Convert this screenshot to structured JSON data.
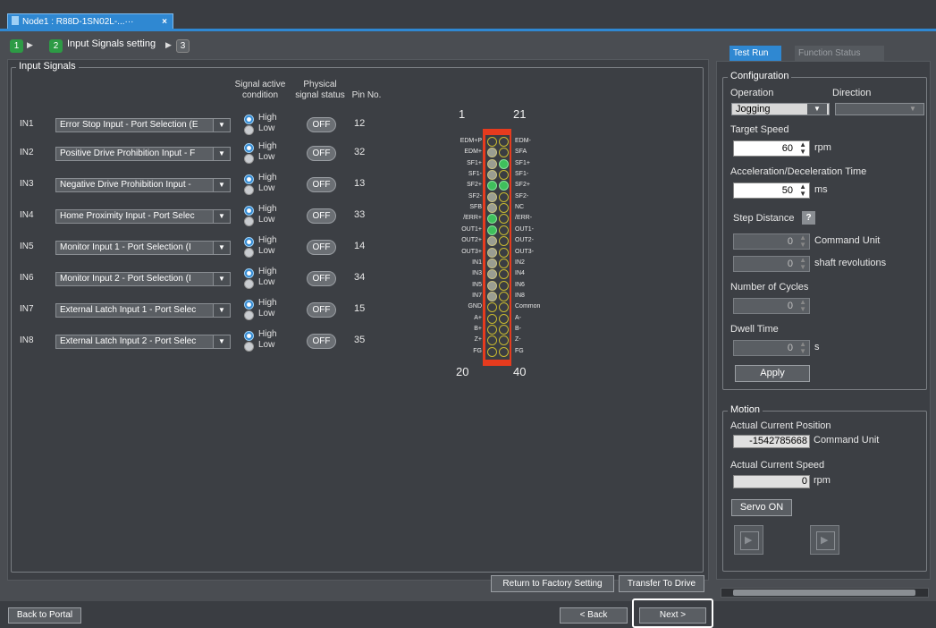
{
  "document_tab": {
    "title": "Node1 : R88D-1SN02L-...···",
    "close": "×"
  },
  "wizard": {
    "steps": [
      "1",
      "2",
      "3"
    ],
    "current_label": "Input Signals setting"
  },
  "input_signals": {
    "group_title": "Input Signals",
    "headers": {
      "signal_active": "Signal active condition",
      "physical_status": "Physical signal status",
      "pin": "Pin No."
    },
    "rows": [
      {
        "id": "IN1",
        "function": "Error Stop Input - Port Selection (E",
        "active": "High",
        "alt": "Low",
        "status": "OFF",
        "pin": "12"
      },
      {
        "id": "IN2",
        "function": "Positive Drive Prohibition Input - F",
        "active": "High",
        "alt": "Low",
        "status": "OFF",
        "pin": "32"
      },
      {
        "id": "IN3",
        "function": "Negative Drive Prohibition Input -",
        "active": "High",
        "alt": "Low",
        "status": "OFF",
        "pin": "13"
      },
      {
        "id": "IN4",
        "function": "Home Proximity Input - Port Selec",
        "active": "High",
        "alt": "Low",
        "status": "OFF",
        "pin": "33"
      },
      {
        "id": "IN5",
        "function": "Monitor Input 1 - Port Selection (I",
        "active": "High",
        "alt": "Low",
        "status": "OFF",
        "pin": "14"
      },
      {
        "id": "IN6",
        "function": "Monitor Input 2 - Port Selection (I",
        "active": "High",
        "alt": "Low",
        "status": "OFF",
        "pin": "34"
      },
      {
        "id": "IN7",
        "function": "External Latch Input 1 - Port Selec",
        "active": "High",
        "alt": "Low",
        "status": "OFF",
        "pin": "15"
      },
      {
        "id": "IN8",
        "function": "External Latch Input 2 - Port Selec",
        "active": "High",
        "alt": "Low",
        "status": "OFF",
        "pin": "35"
      }
    ]
  },
  "connector": {
    "num_top_left": "1",
    "num_top_right": "21",
    "num_bottom_left": "20",
    "num_bottom_right": "40",
    "left_labels": [
      "EDM+P",
      "EDM+",
      "SF1+",
      "SF1-",
      "SF2+",
      "SF2-",
      "SFB",
      "/ERR+",
      "OUT1+",
      "OUT2+",
      "OUT3+",
      "IN1",
      "IN3",
      "IN5",
      "IN7",
      "GND",
      "A+",
      "B+",
      "Z+",
      "FG"
    ],
    "right_labels": [
      "EDM-",
      "SFA",
      "SF1+",
      "SF1-",
      "SF2+",
      "SF2-",
      "NC",
      "/ERR-",
      "OUT1-",
      "OUT2-",
      "OUT3-",
      "IN2",
      "IN4",
      "IN6",
      "IN8",
      "Common",
      "A-",
      "B-",
      "Z-",
      "FG"
    ],
    "left_dots": [
      "empty",
      "gray",
      "gray",
      "gray",
      "green",
      "gray",
      "gray",
      "green",
      "green",
      "gray",
      "gray",
      "gray",
      "gray",
      "gray",
      "gray",
      "empty",
      "empty",
      "empty",
      "empty",
      "empty"
    ],
    "right_dots": [
      "empty",
      "empty",
      "green",
      "empty",
      "green",
      "empty",
      "empty",
      "empty",
      "empty",
      "empty",
      "empty",
      "empty",
      "empty",
      "empty",
      "empty",
      "empty",
      "empty",
      "empty",
      "empty",
      "empty"
    ],
    "colors": {
      "frame": "#e63b1e",
      "active": "#3fbf5c"
    }
  },
  "actions": {
    "factory": "Return to Factory Setting",
    "transfer": "Transfer To Drive",
    "back_portal": "Back to Portal",
    "back": "< Back",
    "next": "Next >"
  },
  "right_panel": {
    "tabs": [
      "Test Run",
      "Function Status"
    ],
    "configuration": {
      "title": "Configuration",
      "operation_label": "Operation",
      "direction_label": "Direction",
      "operation_value": "Jogging",
      "target_speed_label": "Target Speed",
      "target_speed": "60",
      "target_speed_unit": "rpm",
      "accel_label": "Acceleration/Deceleration Time",
      "accel": "50",
      "accel_unit": "ms",
      "step_label": "Step Distance",
      "help": "?",
      "step_cmd": "0",
      "step_cmd_unit": "Command Unit",
      "step_rev": "0",
      "step_rev_unit": "shaft revolutions",
      "cycles_label": "Number of Cycles",
      "cycles": "0",
      "dwell_label": "Dwell Time",
      "dwell": "0",
      "dwell_unit": "s",
      "apply": "Apply"
    },
    "motion": {
      "title": "Motion",
      "position_label": "Actual Current Position",
      "position": "-1542785668",
      "position_unit": "Command Unit",
      "speed_label": "Actual Current Speed",
      "speed": "0",
      "speed_unit": "rpm",
      "servo": "Servo ON"
    }
  }
}
